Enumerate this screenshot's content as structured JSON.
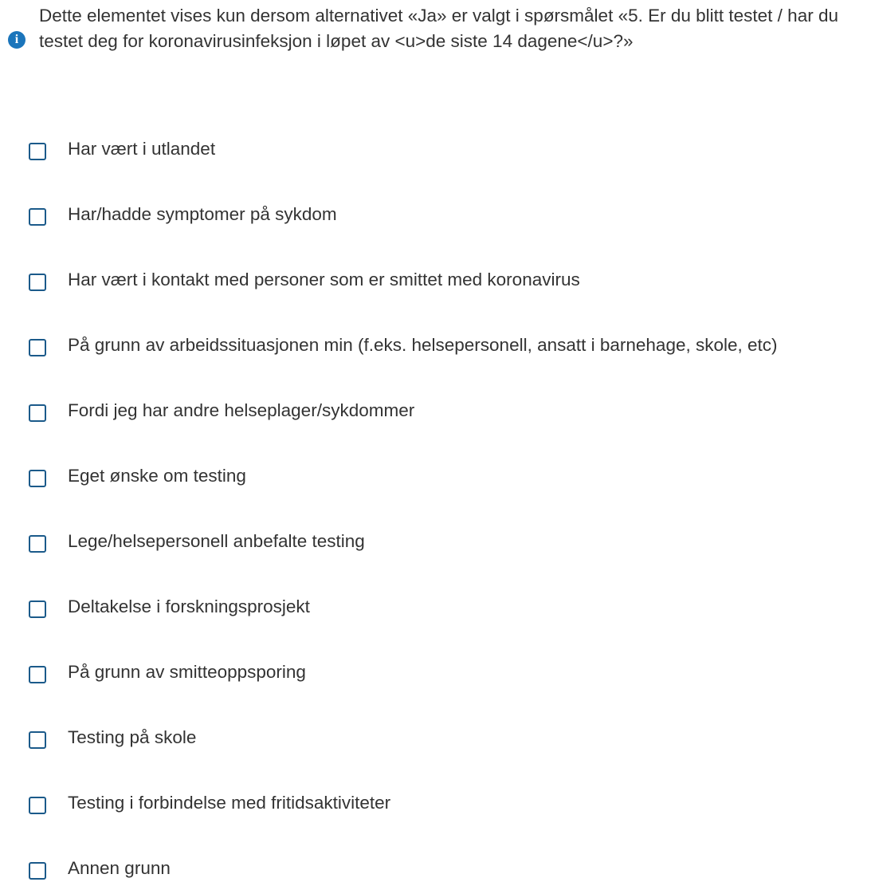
{
  "info": {
    "icon": "info-icon",
    "icon_glyph": "i",
    "text": "Dette elementet vises kun dersom alternativet «Ja» er valgt i spørsmålet «5. Er du blitt testet / har du testet deg for koronavirusinfeksjon i løpet av <u>de siste 14 dagene</u>?»"
  },
  "options": [
    {
      "label": "Har vært i utlandet",
      "checked": false
    },
    {
      "label": "Har/hadde symptomer på sykdom",
      "checked": false
    },
    {
      "label": "Har vært i kontakt med personer som er smittet med koronavirus",
      "checked": false
    },
    {
      "label": "På grunn av arbeidssituasjonen min (f.eks. helsepersonell, ansatt i barnehage, skole, etc)",
      "checked": false
    },
    {
      "label": "Fordi jeg har andre helseplager/sykdommer",
      "checked": false
    },
    {
      "label": "Eget ønske om testing",
      "checked": false
    },
    {
      "label": "Lege/helsepersonell anbefalte testing",
      "checked": false
    },
    {
      "label": "Deltakelse i forskningsprosjekt",
      "checked": false
    },
    {
      "label": "På grunn av smitteoppsporing",
      "checked": false
    },
    {
      "label": "Testing på skole",
      "checked": false
    },
    {
      "label": "Testing i forbindelse med fritidsaktiviteter",
      "checked": false
    },
    {
      "label": "Annen grunn",
      "checked": false
    }
  ],
  "colors": {
    "accent": "#1b75bb",
    "checkbox_border": "#1b5a8a",
    "text": "#333333"
  }
}
